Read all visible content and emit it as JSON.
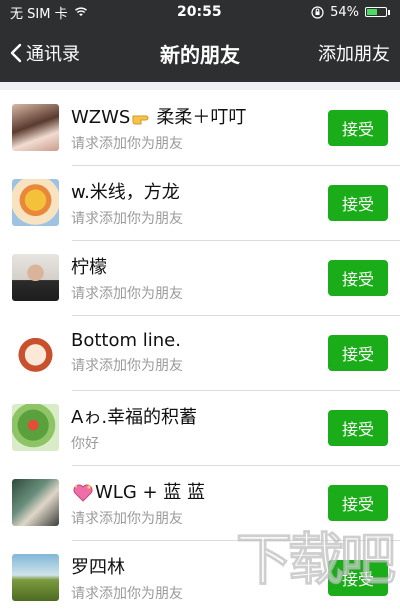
{
  "status_bar": {
    "carrier": "无 SIM 卡",
    "time": "20:55",
    "battery_text": "54%",
    "battery_level": 0.54,
    "battery_color": "#4cd964"
  },
  "nav": {
    "back_label": "通讯录",
    "title": "新的朋友",
    "action_label": "添加朋友",
    "background": "#2d2f31"
  },
  "requests": [
    {
      "name_a": "WZWS",
      "name_b": "柔柔＋叮叮",
      "emoji": "pointing-hand-icon",
      "message": "请求添加你为朋友",
      "button": "接受"
    },
    {
      "name_a": "w.米线，方龙",
      "name_b": "",
      "message": "请求添加你为朋友",
      "button": "接受"
    },
    {
      "name_a": "柠檬",
      "name_b": "",
      "message": "请求添加你为朋友",
      "button": "接受"
    },
    {
      "name_a": "Bottom line.",
      "name_b": "",
      "message": "请求添加你为朋友",
      "button": "接受"
    },
    {
      "name_a": "Aゎ.幸福的积蓄",
      "name_b": "",
      "message": "你好",
      "button": "接受"
    },
    {
      "name_a": "WLG + 蓝 蓝",
      "name_b": "",
      "emoji": "sparkling-heart-icon",
      "message": "请求添加你为朋友",
      "button": "接受"
    },
    {
      "name_a": "罗四林",
      "name_b": "",
      "message": "请求添加你为朋友",
      "button": "接受"
    }
  ],
  "accent_color": "#1aad19",
  "watermark": "下载吧"
}
